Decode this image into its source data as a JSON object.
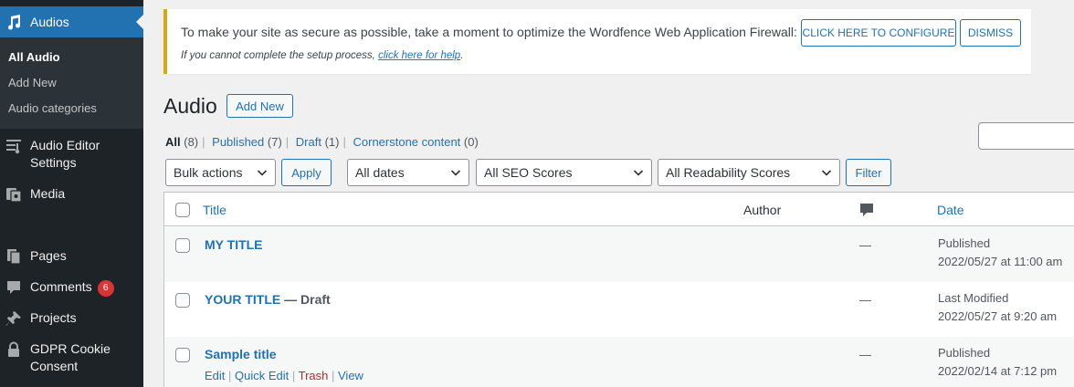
{
  "sidebar": {
    "active": {
      "label": "Audios",
      "icon": "music-icon"
    },
    "submenu": [
      "All Audio",
      "Add New",
      "Audio categories"
    ],
    "items": [
      {
        "label": "Audio Editor Settings",
        "line1": "Audio Editor",
        "line2": "Settings",
        "icon": "editor-settings-icon"
      },
      {
        "label": "Media",
        "icon": "media-icon"
      },
      {
        "label": "Pages",
        "icon": "pages-icon"
      },
      {
        "label": "Comments",
        "icon": "comments-icon",
        "badge": "6"
      },
      {
        "label": "Projects",
        "icon": "pin-icon"
      },
      {
        "label": "GDPR Cookie Consent",
        "line1": "GDPR Cookie",
        "line2": "Consent",
        "icon": "lock-icon"
      }
    ]
  },
  "notice": {
    "message": "To make your site as secure as possible, take a moment to optimize the Wordfence Web Application Firewall:",
    "configure_button": "CLICK HERE TO CONFIGURE",
    "dismiss_button": "DISMISS",
    "sub_prefix": "If you cannot complete the setup process, ",
    "sub_link": "click here for help",
    "sub_suffix": "."
  },
  "page": {
    "title": "Audio",
    "add_new": "Add New"
  },
  "views": [
    {
      "label": "All",
      "count": "(8)"
    },
    {
      "label": "Published",
      "count": "(7)"
    },
    {
      "label": "Draft",
      "count": "(1)"
    },
    {
      "label": "Cornerstone content",
      "count": "(0)"
    }
  ],
  "filters": {
    "bulk_actions": "Bulk actions",
    "apply": "Apply",
    "dates": "All dates",
    "seo": "All SEO Scores",
    "readability": "All Readability Scores",
    "filter": "Filter"
  },
  "table": {
    "columns": {
      "title": "Title",
      "author": "Author",
      "comments_icon": "comment-bubble-icon",
      "date": "Date"
    },
    "rows": [
      {
        "title": "MY TITLE",
        "state": "",
        "comments": "—",
        "status": "Published",
        "date": "2022/05/27 at 11:00 am"
      },
      {
        "title": "YOUR TITLE",
        "state": " — Draft",
        "comments": "—",
        "status": "Last Modified",
        "date": "2022/05/27 at 9:20 am"
      },
      {
        "title": "Sample title",
        "state": "",
        "comments": "—",
        "status": "Published",
        "date": "2022/02/14 at 7:12 pm"
      }
    ],
    "row_actions": [
      "Edit",
      "Quick Edit",
      "Trash",
      "View"
    ]
  }
}
